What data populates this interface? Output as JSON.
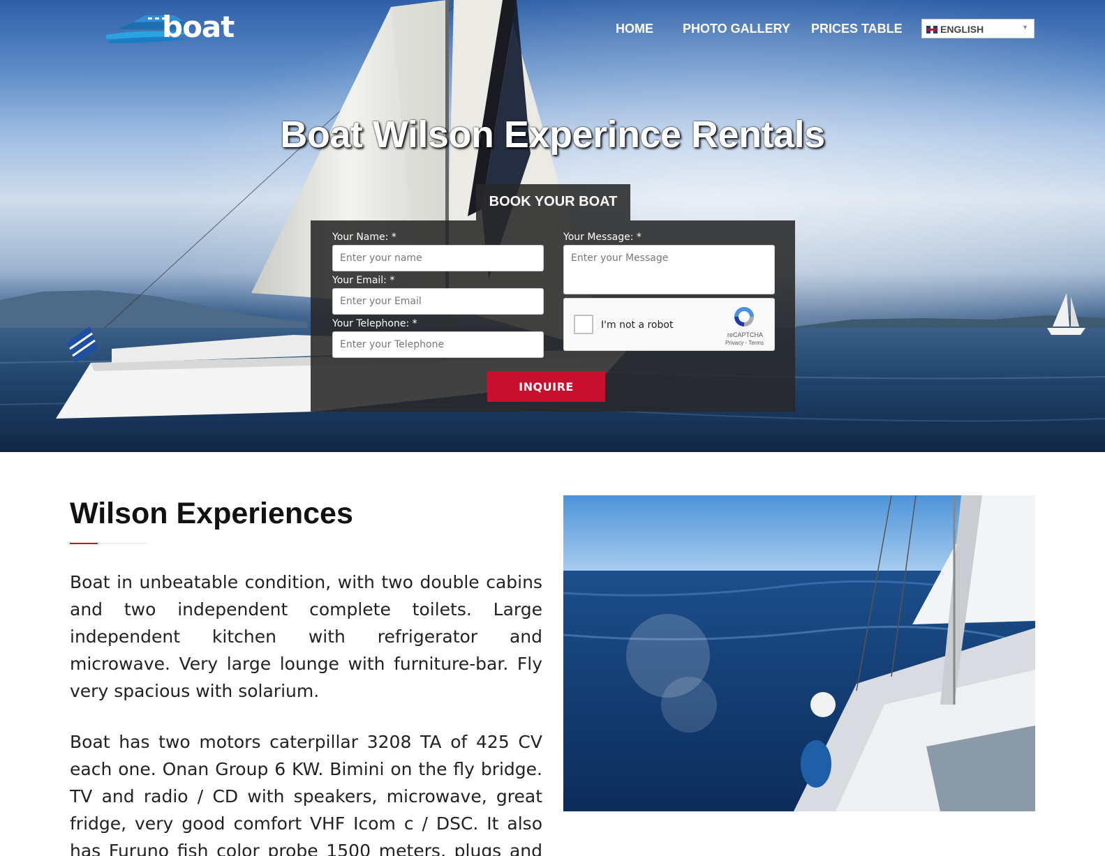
{
  "header": {
    "logo_text": "boat",
    "nav": [
      "HOME",
      "PHOTO GALLERY",
      "PRICES TABLE"
    ],
    "language": "ENGLISH"
  },
  "hero": {
    "title": "Boat Wilson Experince Rentals"
  },
  "booking": {
    "tab_label": "BOOK YOUR BOAT",
    "name_label": "Your Name: *",
    "name_placeholder": "Enter your name",
    "email_label": "Your Email: *",
    "email_placeholder": "Enter your Email",
    "phone_label": "Your Telephone: *",
    "phone_placeholder": "Enter your Telephone",
    "message_label": "Your Message: *",
    "message_placeholder": "Enter your Message",
    "captcha_text": "I'm not a robot",
    "captcha_brand": "reCAPTCHA",
    "captcha_terms": "Privacy - Terms",
    "submit_label": "INQUIRE"
  },
  "content": {
    "title": "Wilson Experiences",
    "paragraph1": "Boat in unbeatable condition, with two double cabins and two independent complete toilets. Large independent kitchen with refrigerator and microwave. Very large lounge with furniture-bar. Fly very spacious with solarium.",
    "paragraph2": "Boat has two motors caterpillar 3208 TA of 425 CV each one. Onan Group 6 KW. Bimini on the fly bridge. TV and radio / CD with speakers, microwave, great fridge, very good comfort VHF Icom c / DSC. It also has Furuno fish color probe 1500 meters, plugs and brackets for fishing"
  },
  "colors": {
    "accent": "#c8102e",
    "form_bg": "#282828"
  }
}
